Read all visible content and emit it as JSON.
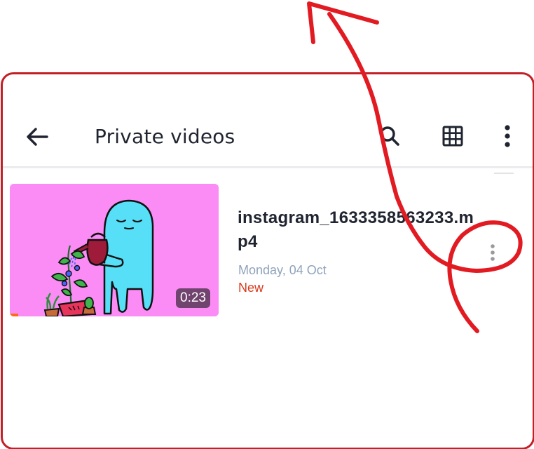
{
  "header": {
    "title": "Private videos",
    "back_icon": "arrow-left-icon",
    "search_icon": "search-icon",
    "grid_icon": "grid-view-icon",
    "menu_icon": "more-vertical-icon"
  },
  "videos": [
    {
      "name": "instagram_1633358563233.mp4",
      "date": "Monday, 04 Oct",
      "badge": "New",
      "duration": "0:23",
      "watched_fraction": 0.04,
      "menu_icon": "more-vertical-icon"
    }
  ],
  "colors": {
    "annotation": "#e21b23",
    "frame": "#c41f27",
    "new_badge": "#d93a1e",
    "date_text": "#8fa3bb",
    "thumbnail_bg": "#fb8cf5"
  }
}
